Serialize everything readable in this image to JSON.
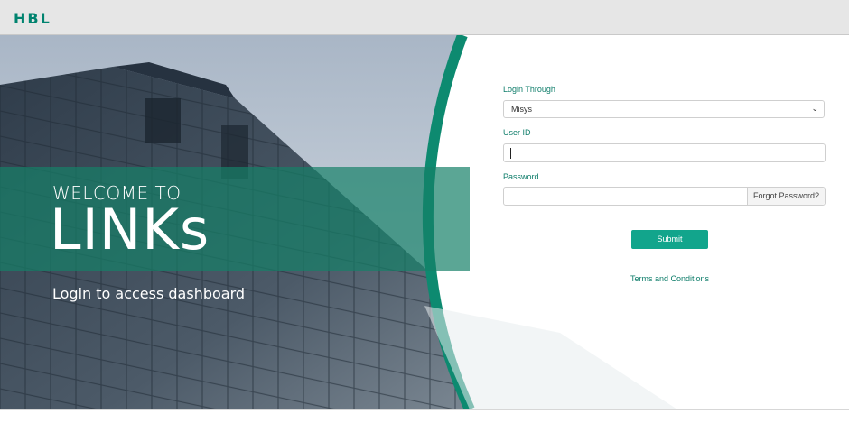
{
  "header": {
    "logo_text": "HBL"
  },
  "hero": {
    "welcome_line": "WELCOME TO",
    "app_name": "LINKs",
    "subtitle": "Login to access dashboard"
  },
  "login_form": {
    "login_through_label": "Login Through",
    "login_through_value": "Misys",
    "user_id_label": "User ID",
    "user_id_value": "",
    "password_label": "Password",
    "password_value": "",
    "forgot_password_label": "Forgot Password?",
    "submit_label": "Submit",
    "terms_label": "Terms and Conditions"
  },
  "colors": {
    "brand_green": "#00836f",
    "button_teal": "#12a58c",
    "label_teal": "#0e7d6a"
  }
}
